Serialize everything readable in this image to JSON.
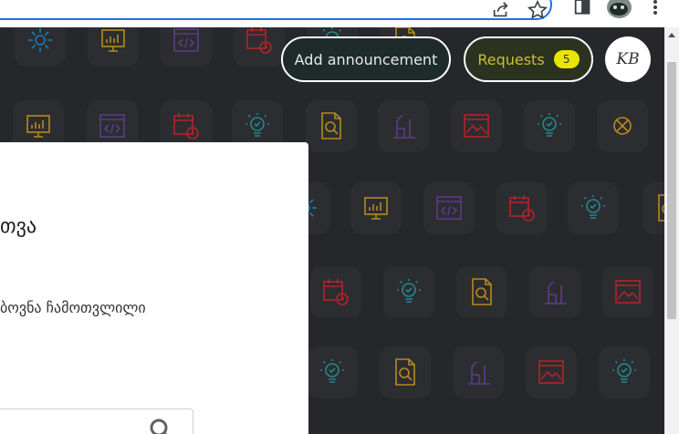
{
  "browser": {
    "icons": [
      "share-icon",
      "star-icon",
      "side-panel-icon",
      "extension-avatar",
      "more-icon"
    ]
  },
  "header": {
    "announce_label": "Add announcement",
    "requests_label": "Requests",
    "requests_count": "5",
    "avatar_initials": "KB"
  },
  "panel": {
    "title_fragment": "თვა",
    "text_fragment": "ბოვნა ჩამოთვლილი"
  },
  "colors": {
    "background": "#26272b",
    "tile": "#2c2d31",
    "requests_accent": "#e9e400",
    "icon_blue": "#1e7bb0",
    "icon_gold": "#b58a1d",
    "icon_purple": "#5a3c88",
    "icon_red": "#b3232a",
    "icon_teal": "#1f8a8f"
  },
  "background_icons": [
    "gear-icon",
    "chart-icon",
    "code-icon",
    "calendar-icon",
    "bulb-icon",
    "search-doc-icon",
    "plant-icon",
    "image-icon",
    "tools-icon"
  ]
}
